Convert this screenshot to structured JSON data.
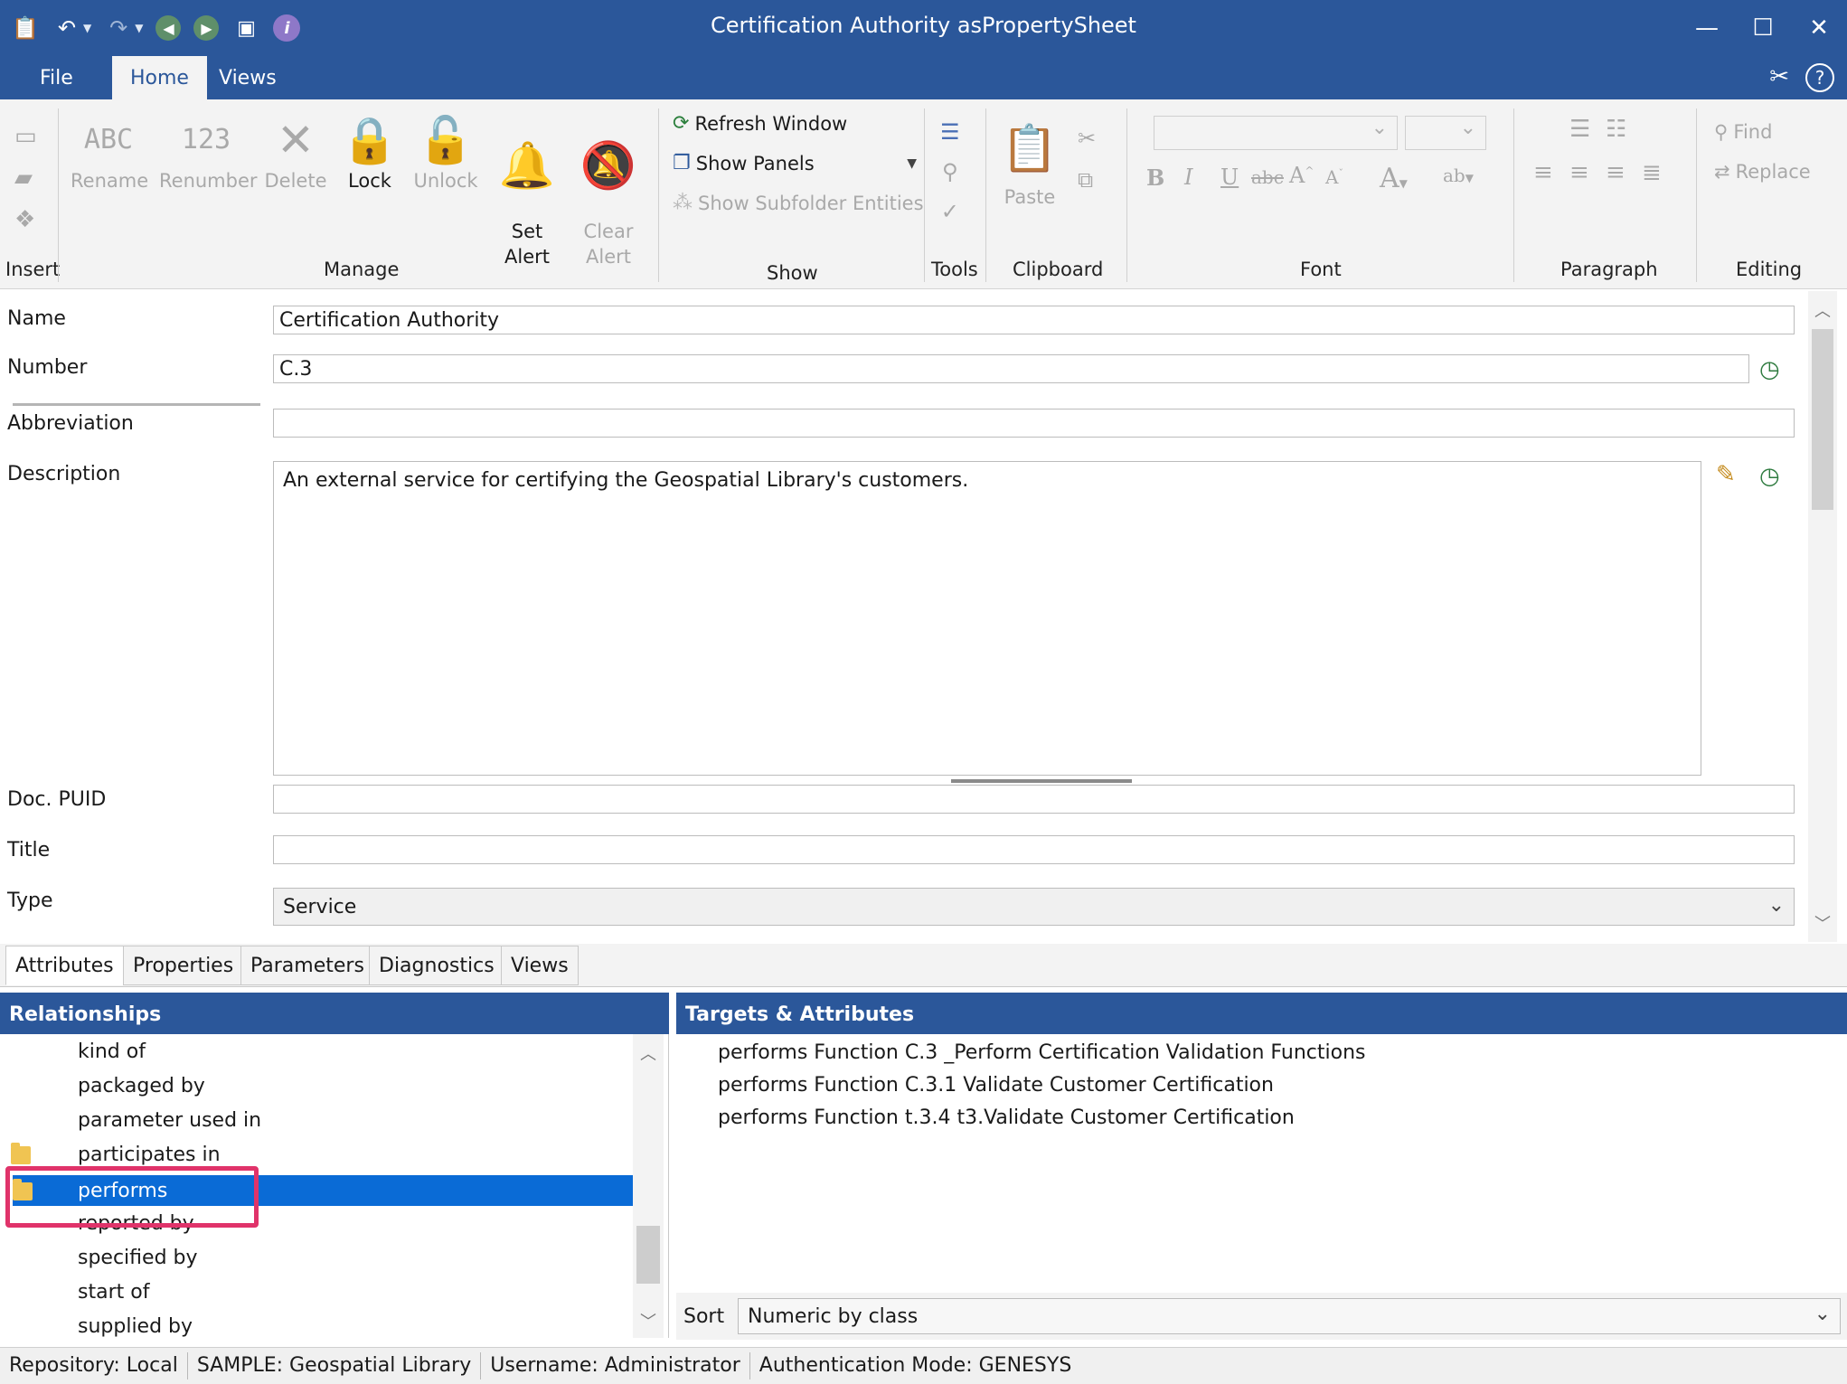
{
  "window": {
    "title": "Certification Authority asPropertySheet"
  },
  "ribbon_tabs": [
    "File",
    "Home",
    "Views"
  ],
  "ribbon": {
    "insert": {
      "label": "Insert"
    },
    "manage": {
      "label": "Manage",
      "buttons": [
        "Rename",
        "Renumber",
        "Delete",
        "Lock",
        "Unlock",
        "Set\nAlert",
        "Clear\nAlert"
      ]
    },
    "show": {
      "label": "Show",
      "refresh": "Refresh Window",
      "panels": "Show Panels",
      "subfolder": "Show Subfolder Entities"
    },
    "tools": {
      "label": "Tools"
    },
    "clipboard": {
      "label": "Clipboard",
      "paste": "Paste"
    },
    "font": {
      "label": "Font"
    },
    "paragraph": {
      "label": "Paragraph"
    },
    "editing": {
      "label": "Editing",
      "find": "Find",
      "replace": "Replace"
    }
  },
  "form": {
    "name": {
      "label": "Name",
      "value": "Certification Authority"
    },
    "number": {
      "label": "Number",
      "value": "C.3"
    },
    "abbreviation": {
      "label": "Abbreviation",
      "value": ""
    },
    "description": {
      "label": "Description",
      "value": "An external service for certifying the Geospatial Library's customers."
    },
    "doc_puid": {
      "label": "Doc. PUID",
      "value": ""
    },
    "title": {
      "label": "Title",
      "value": ""
    },
    "type": {
      "label": "Type",
      "value": "Service"
    }
  },
  "lower_tabs": [
    "Attributes",
    "Properties",
    "Parameters",
    "Diagnostics",
    "Views"
  ],
  "relationships": {
    "header": "Relationships",
    "items": [
      "kind of",
      "packaged by",
      "parameter used in",
      "participates in",
      "performs",
      "reported by",
      "specified by",
      "start of",
      "supplied by"
    ],
    "selected": "performs"
  },
  "targets": {
    "header": "Targets & Attributes",
    "items": [
      "performs Function C.3 _Perform Certification Validation Functions",
      "performs Function C.3.1 Validate Customer Certification",
      "performs Function t.3.4 t3.Validate Customer Certification"
    ],
    "sort_label": "Sort",
    "sort_value": "Numeric by class"
  },
  "status": {
    "repository": "Repository: Local",
    "project": "SAMPLE: Geospatial Library",
    "user": "Username: Administrator",
    "auth": "Authentication Mode: GENESYS"
  },
  "colors": {
    "accent": "#2b579a",
    "selection": "#0a6bd6",
    "highlight": "#e0336a"
  }
}
